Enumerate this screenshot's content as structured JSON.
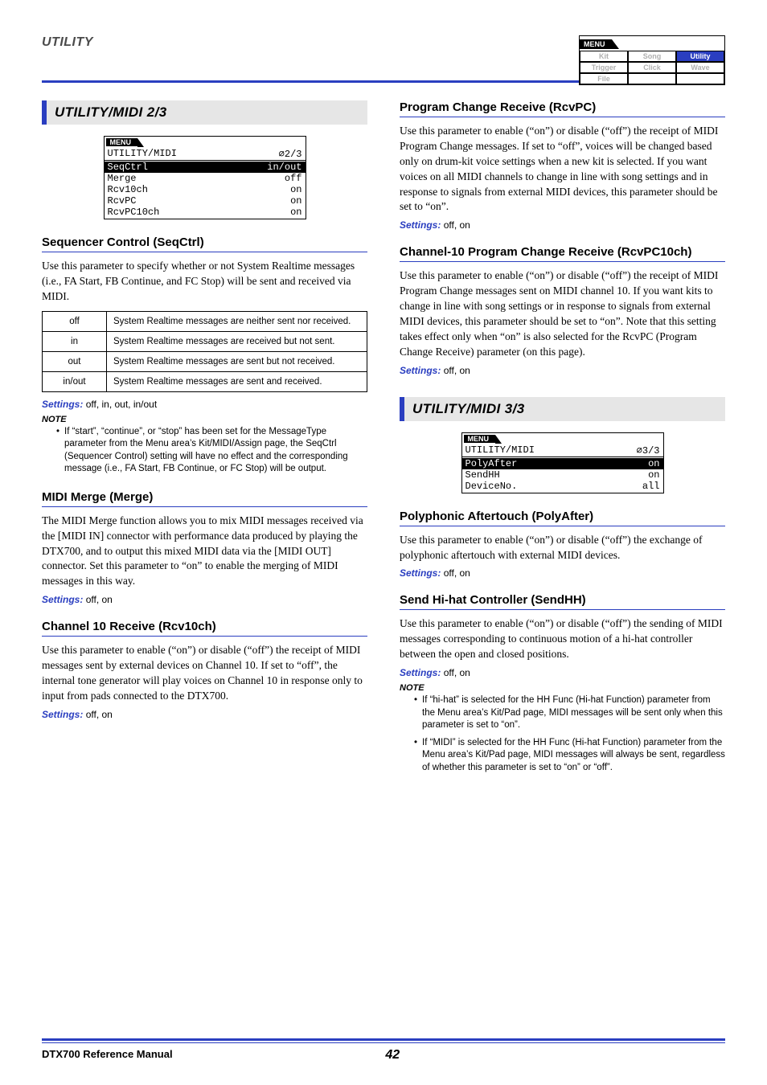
{
  "header": {
    "corner": "UTILITY"
  },
  "menu_widget": {
    "tab": "MENU",
    "cells": [
      "Kit",
      "Song",
      "Utility",
      "Trigger",
      "Click",
      "Wave",
      "File",
      "",
      ""
    ],
    "active_index": 2
  },
  "left": {
    "section_title": "UTILITY/MIDI  2/3",
    "lcd": {
      "tab": "MENU",
      "title_left": "UTILITY/MIDI",
      "title_right": "∅2/3",
      "rows": [
        {
          "l": "SeqCtrl",
          "r": "in/out",
          "hl": true
        },
        {
          "l": "Merge",
          "r": "off"
        },
        {
          "l": "Rcv10ch",
          "r": "on"
        },
        {
          "l": "RcvPC",
          "r": "on"
        },
        {
          "l": "RcvPC10ch",
          "r": "on"
        }
      ]
    },
    "seqctrl": {
      "head": "Sequencer Control (SeqCtrl)",
      "body": "Use this parameter to specify whether or not System Realtime messages (i.e., FA Start, FB Continue, and FC Stop) will be sent and received via MIDI.",
      "table": [
        {
          "k": "off",
          "v": "System Realtime messages are neither sent nor received."
        },
        {
          "k": "in",
          "v": "System Realtime messages are received but not sent."
        },
        {
          "k": "out",
          "v": "System Realtime messages are sent but not received."
        },
        {
          "k": "in/out",
          "v": "System Realtime messages are sent and received."
        }
      ],
      "settings": "off, in, out, in/out",
      "note_label": "NOTE",
      "note": "If “start”, “continue”, or “stop” has been set for the MessageType parameter from the Menu area’s Kit/MIDI/Assign page, the SeqCtrl (Sequencer Control) setting will have no effect and the corresponding message (i.e., FA Start, FB Continue, or FC Stop) will be output."
    },
    "merge": {
      "head": "MIDI Merge (Merge)",
      "body": "The MIDI Merge function allows you to mix MIDI messages received via the [MIDI IN] connector with performance data produced by playing the DTX700, and to output this mixed MIDI data via the [MIDI OUT] connector. Set this parameter to “on” to enable the merging of MIDI messages in this way.",
      "settings": "off, on"
    },
    "rcv10ch": {
      "head": "Channel 10 Receive (Rcv10ch)",
      "body": "Use this parameter to enable (“on”) or disable (“off”) the receipt of MIDI messages sent by external devices on Channel 10. If set to “off”, the internal tone generator will play voices on Channel 10 in response only to input from pads connected to the DTX700.",
      "settings": "off, on"
    }
  },
  "right": {
    "rcvpc": {
      "head": "Program Change Receive (RcvPC)",
      "body": "Use this parameter to enable (“on”) or disable (“off”) the receipt of MIDI Program Change messages. If set to “off”, voices will be changed based only on drum-kit voice settings when a new kit is selected. If you want voices on all MIDI channels to change in line with song settings and in response to signals from external MIDI devices, this parameter should be set to “on”.",
      "settings": "off, on"
    },
    "rcvpc10": {
      "head": "Channel-10 Program Change Receive (RcvPC10ch)",
      "body": "Use this parameter to enable (“on”) or disable (“off”) the receipt of MIDI Program Change messages sent on MIDI channel 10. If you want kits to change in line with song settings or in response to signals from external MIDI devices, this parameter should be set to “on”. Note that this setting takes effect only when “on” is also selected for the RcvPC (Program Change Receive) parameter (on this page).",
      "settings": "off, on"
    },
    "section_title": "UTILITY/MIDI  3/3",
    "lcd": {
      "tab": "MENU",
      "title_left": "UTILITY/MIDI",
      "title_right": "∅3/3",
      "rows": [
        {
          "l": "PolyAfter",
          "r": "on",
          "hl": true
        },
        {
          "l": "SendHH",
          "r": "on"
        },
        {
          "l": "DeviceNo.",
          "r": "all"
        }
      ]
    },
    "polyafter": {
      "head": "Polyphonic Aftertouch (PolyAfter)",
      "body": "Use this parameter to enable (“on”) or disable (“off”) the exchange of polyphonic aftertouch with external MIDI devices.",
      "settings": "off, on"
    },
    "sendhh": {
      "head": "Send Hi-hat Controller (SendHH)",
      "body": "Use this parameter to enable (“on”) or disable (“off”) the sending of MIDI messages corresponding to continuous motion of a hi-hat controller between the open and closed positions.",
      "settings": "off, on",
      "note_label": "NOTE",
      "notes": [
        "If “hi-hat” is selected for the HH Func (Hi-hat Function) parameter from the Menu area’s Kit/Pad page, MIDI messages will be sent only when this parameter is set to “on”.",
        "If “MIDI” is selected for the HH Func (Hi-hat Function) parameter from the Menu area’s Kit/Pad page, MIDI messages will always be sent, regardless of whether this parameter is set to “on” or “off”."
      ]
    }
  },
  "settings_label": "Settings:",
  "footer": {
    "manual": "DTX700  Reference Manual",
    "page": "42"
  }
}
